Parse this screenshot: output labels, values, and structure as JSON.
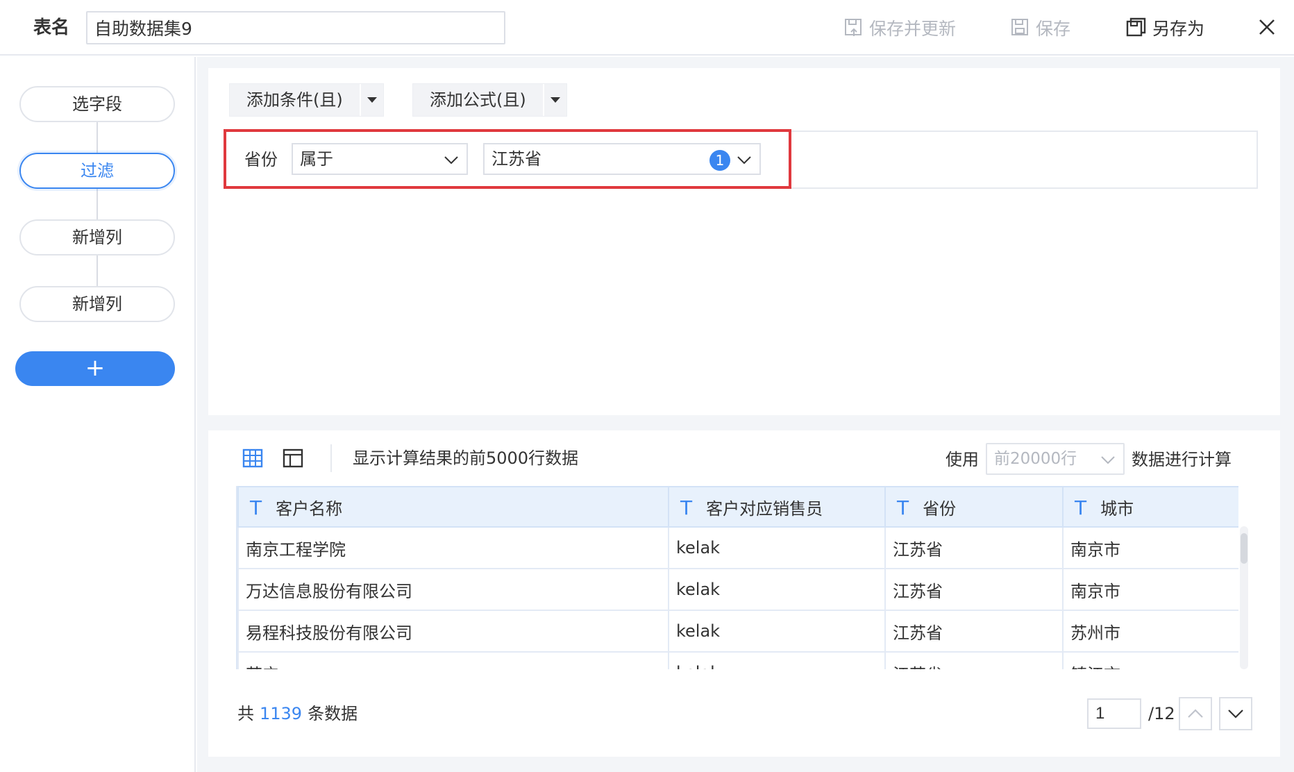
{
  "header": {
    "table_name_label": "表名",
    "table_name_value": "自助数据集9",
    "save_update_label": "保存并更新",
    "save_label": "保存",
    "save_as_label": "另存为"
  },
  "sidebar": {
    "steps": [
      {
        "label": "选字段",
        "active": false
      },
      {
        "label": "过滤",
        "active": true
      },
      {
        "label": "新增列",
        "active": false
      },
      {
        "label": "新增列",
        "active": false
      }
    ],
    "add_label": "+"
  },
  "filter": {
    "add_condition_label": "添加条件(且)",
    "add_formula_label": "添加公式(且)",
    "condition": {
      "field": "省份",
      "operator": "属于",
      "value": "江苏省",
      "value_count": "1"
    }
  },
  "preview": {
    "note": "显示计算结果的前5000行数据",
    "use_label": "使用",
    "row_option": "前20000行",
    "calc_label": "数据进行计算",
    "columns": [
      {
        "type": "T",
        "name": "客户名称"
      },
      {
        "type": "T",
        "name": "客户对应销售员"
      },
      {
        "type": "T",
        "name": "省份"
      },
      {
        "type": "T",
        "name": "城市"
      }
    ],
    "rows": [
      [
        "南京工程学院",
        "kelak",
        "江苏省",
        "南京市"
      ],
      [
        "万达信息股份有限公司",
        "kelak",
        "江苏省",
        "南京市"
      ],
      [
        "易程科技股份有限公司",
        "kelak",
        "江苏省",
        "苏州市"
      ],
      [
        "苏宁",
        "kelak",
        "江苏省",
        "镇江市"
      ]
    ],
    "total_prefix": "共",
    "total_count": "1139",
    "total_suffix": "条数据",
    "current_page": "1",
    "total_pages": "/12"
  },
  "colors": {
    "accent": "#3a86f0",
    "highlight": "#e0393e",
    "disabled": "#b4b8c0"
  }
}
